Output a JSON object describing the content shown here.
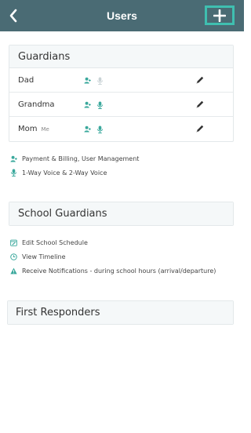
{
  "header": {
    "title": "Users",
    "back_icon": "chevron-left-icon",
    "add_icon": "plus-icon"
  },
  "guardians": {
    "title": "Guardians",
    "rows": [
      {
        "name": "Dad",
        "me_tag": "",
        "admin": true,
        "voice": false
      },
      {
        "name": "Grandma",
        "me_tag": "",
        "admin": true,
        "voice": true
      },
      {
        "name": "Mom",
        "me_tag": "Me",
        "admin": true,
        "voice": true
      }
    ],
    "legend": [
      {
        "icon": "user-admin-icon",
        "text": "Payment & Billing, User Management"
      },
      {
        "icon": "microphone-icon",
        "text": "1-Way Voice & 2-Way Voice"
      }
    ]
  },
  "school_guardians": {
    "title": "School Guardians",
    "legend": [
      {
        "icon": "calendar-edit-icon",
        "text": "Edit School Schedule"
      },
      {
        "icon": "clock-icon",
        "text": "View Timeline"
      },
      {
        "icon": "warning-icon",
        "text": "Receive Notifications - during school hours (arrival/departure)"
      }
    ]
  },
  "first_responders": {
    "title": "First Responders"
  },
  "colors": {
    "header_bg": "#4a6b74",
    "accent": "#3fbfb0",
    "icon_active": "#3aa89c",
    "icon_inactive": "#c9d3d6"
  }
}
